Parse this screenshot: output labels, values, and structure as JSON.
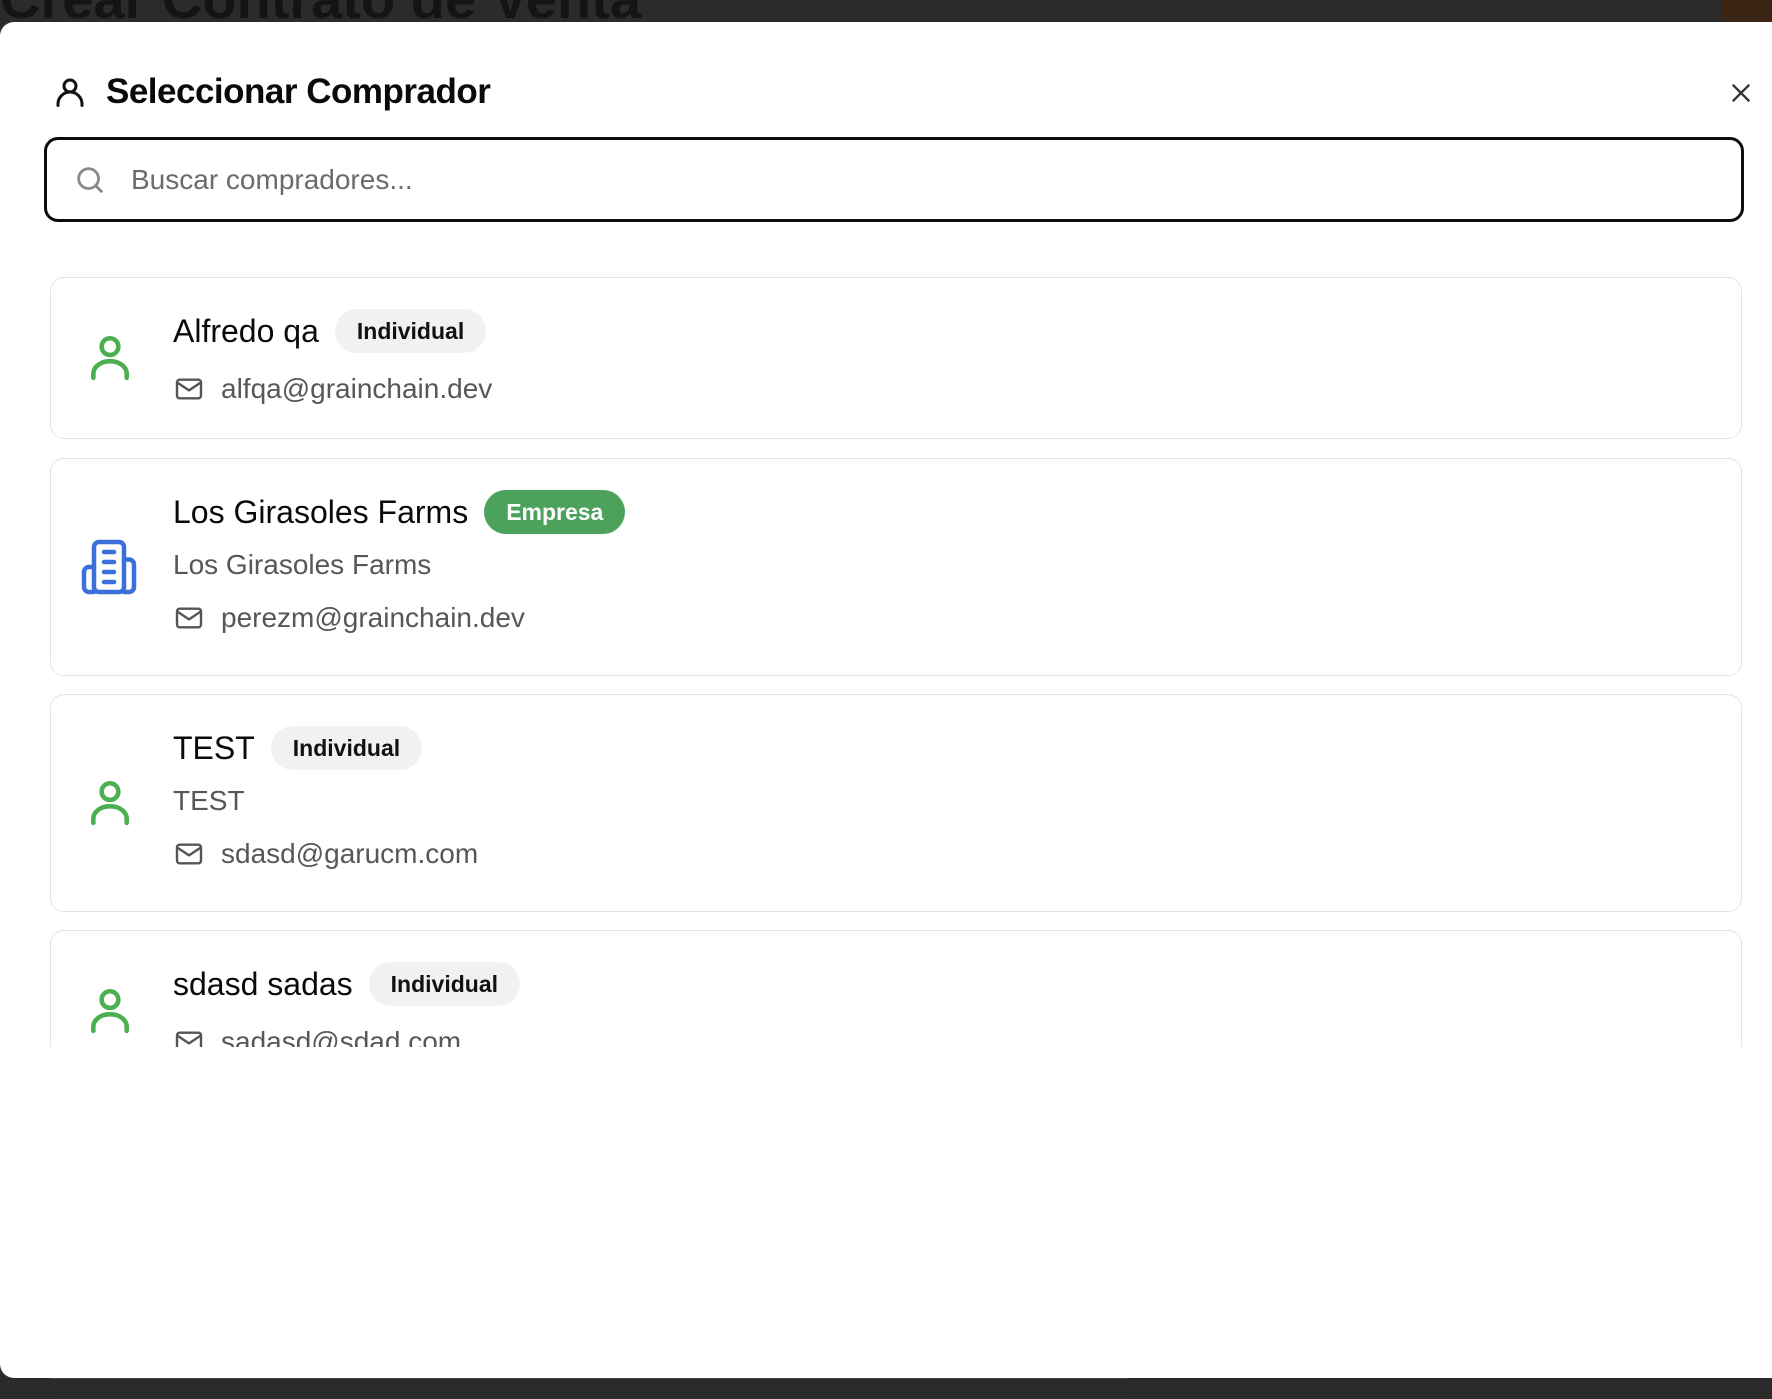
{
  "background": {
    "page_title": "Crear Contrato de Venta"
  },
  "dialog": {
    "title": "Seleccionar Comprador",
    "title_icon": "user-icon",
    "close_icon": "close-icon"
  },
  "search": {
    "placeholder": "Buscar compradores...",
    "value": "",
    "icon": "search-icon"
  },
  "buyers": [
    {
      "name": "Alfredo qa",
      "type": "Individual",
      "company": "",
      "email": "alfqa@grainchain.dev",
      "avatar_icon": "user-icon",
      "avatar_color": "#4caf50"
    },
    {
      "name": "Los Girasoles Farms",
      "type": "Empresa",
      "company": "Los Girasoles Farms",
      "email": "perezm@grainchain.dev",
      "avatar_icon": "building-icon",
      "avatar_color": "#3b6fd9"
    },
    {
      "name": "TEST",
      "type": "Individual",
      "company": "TEST",
      "email": "sdasd@garucm.com",
      "avatar_icon": "user-icon",
      "avatar_color": "#4caf50"
    },
    {
      "name": "sdasd sadas",
      "type": "Individual",
      "company": "",
      "email": "sadasd@sdad.com",
      "avatar_icon": "user-icon",
      "avatar_color": "#4caf50"
    }
  ],
  "colors": {
    "individual_badge_bg": "#f1f1f2",
    "empresa_badge_bg": "#4ca15c",
    "individual_avatar": "#4caf50",
    "company_avatar": "#3b6fd9"
  }
}
